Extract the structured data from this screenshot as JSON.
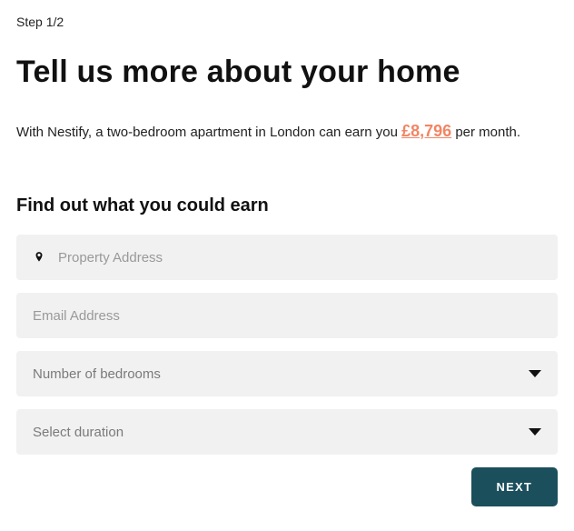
{
  "step": "Step 1/2",
  "title": "Tell us more about your home",
  "intro_prefix": "With Nestify, a two-bedroom apartment in London can earn you ",
  "earn_amount": "£8,796",
  "intro_suffix": " per month.",
  "subhead": "Find out what you could earn",
  "fields": {
    "address_placeholder": "Property Address",
    "email_placeholder": "Email Address",
    "bedrooms_placeholder": "Number of bedrooms",
    "duration_placeholder": "Select duration"
  },
  "next_label": "NEXT"
}
